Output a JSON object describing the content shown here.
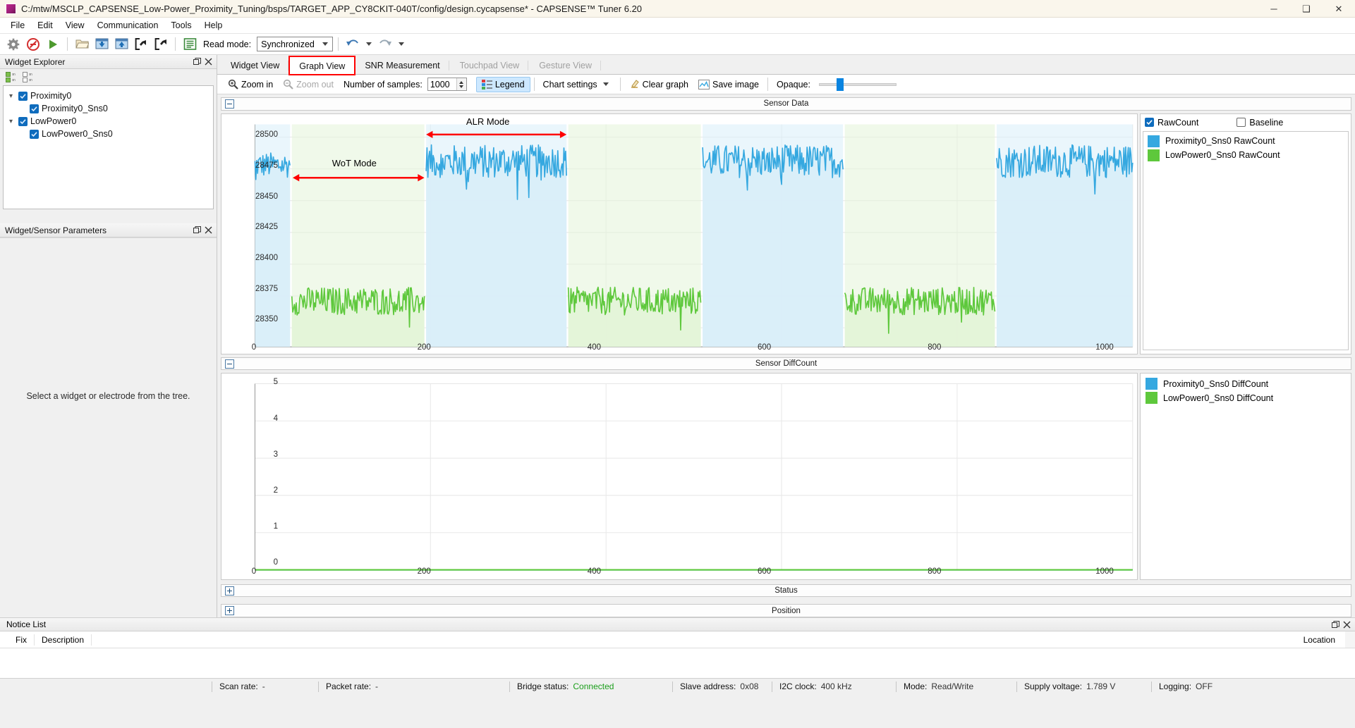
{
  "window": {
    "title": "C:/mtw/MSCLP_CAPSENSE_Low-Power_Proximity_Tuning/bsps/TARGET_APP_CY8CKIT-040T/config/design.cycapsense* - CAPSENSE™ Tuner 6.20",
    "minimize": "─",
    "maximize": "❑",
    "close": "✕"
  },
  "menu": {
    "items": [
      "File",
      "Edit",
      "View",
      "Communication",
      "Tools",
      "Help"
    ]
  },
  "toolbar": {
    "read_mode_label": "Read mode:",
    "read_mode_value": "Synchronized",
    "icons": [
      "settings-gear",
      "disconnect",
      "start",
      "open-file",
      "apply-to-device",
      "apply-to-project",
      "import",
      "export",
      "log"
    ]
  },
  "tabs": [
    {
      "label": "Widget View",
      "selected": false,
      "disabled": false,
      "highlight": false
    },
    {
      "label": "Graph View",
      "selected": true,
      "disabled": false,
      "highlight": true
    },
    {
      "label": "SNR Measurement",
      "selected": false,
      "disabled": false,
      "highlight": false
    },
    {
      "label": "Touchpad View",
      "selected": false,
      "disabled": true,
      "highlight": false
    },
    {
      "label": "Gesture View",
      "selected": false,
      "disabled": true,
      "highlight": false
    }
  ],
  "graph_toolbar": {
    "zoom_in": "Zoom in",
    "zoom_out": "Zoom out",
    "samples_label": "Number of samples:",
    "samples_value": "1000",
    "legend": "Legend",
    "chart_settings": "Chart settings",
    "clear_graph": "Clear graph",
    "save_image": "Save image",
    "opaque_label": "Opaque:"
  },
  "widget_explorer": {
    "title": "Widget Explorer",
    "tree": [
      {
        "label": "Proximity0",
        "level": 0,
        "checked": true,
        "expanded": true
      },
      {
        "label": "Proximity0_Sns0",
        "level": 1,
        "checked": true
      },
      {
        "label": "LowPower0",
        "level": 0,
        "checked": true,
        "expanded": true
      },
      {
        "label": "LowPower0_Sns0",
        "level": 1,
        "checked": true
      }
    ]
  },
  "widget_params": {
    "title": "Widget/Sensor Parameters",
    "empty_message": "Select a widget or electrode from the tree."
  },
  "sections": {
    "sensor_data": "Sensor Data",
    "sensor_diffcount": "Sensor DiffCount",
    "status": "Status",
    "position": "Position"
  },
  "raw_legend": {
    "rawcount_label": "RawCount",
    "rawcount_checked": true,
    "baseline_label": "Baseline",
    "baseline_checked": false,
    "series": [
      {
        "name": "Proximity0_Sns0 RawCount",
        "color": "#35a8e0"
      },
      {
        "name": "LowPower0_Sns0 RawCount",
        "color": "#5ec83c"
      }
    ]
  },
  "diff_legend": {
    "series": [
      {
        "name": "Proximity0_Sns0 DiffCount",
        "color": "#35a8e0"
      },
      {
        "name": "LowPower0_Sns0 DiffCount",
        "color": "#5ec83c"
      }
    ]
  },
  "annotations": {
    "wot": "WoT Mode",
    "alr": "ALR Mode"
  },
  "notice_list": {
    "title": "Notice List",
    "col_fix": "Fix",
    "col_description": "Description",
    "col_location": "Location"
  },
  "status_bar": [
    {
      "key": "Scan rate:",
      "value": "-",
      "state": ""
    },
    {
      "key": "Packet rate:",
      "value": "-",
      "state": ""
    },
    {
      "key": "Bridge status:",
      "value": "Connected",
      "state": "ok"
    },
    {
      "key": "Slave address:",
      "value": "0x08",
      "state": ""
    },
    {
      "key": "I2C clock:",
      "value": "400 kHz",
      "state": ""
    },
    {
      "key": "Mode:",
      "value": "Read/Write",
      "state": ""
    },
    {
      "key": "Supply voltage:",
      "value": "1.789 V",
      "state": ""
    },
    {
      "key": "Logging:",
      "value": "OFF",
      "state": ""
    }
  ],
  "chart_data": [
    {
      "id": "sensor-data",
      "type": "line",
      "title": "Sensor Data",
      "xlabel": "",
      "ylabel": "",
      "xlim": [
        0,
        1000
      ],
      "ylim": [
        28335,
        28510
      ],
      "xticks": [
        0,
        200,
        400,
        600,
        800,
        1000
      ],
      "yticks": [
        28350,
        28375,
        28400,
        28425,
        28450,
        28475,
        28500
      ],
      "grid": true,
      "legend_position": "right",
      "series": [
        {
          "name": "Proximity0_Sns0 RawCount",
          "color": "#35a8e0",
          "fill": "#d9eef9",
          "segments": [
            {
              "x_start": 0,
              "x_end": 40,
              "mean": 28478,
              "noise": 10
            },
            {
              "x_start": 195,
              "x_end": 355,
              "mean": 28481,
              "noise": 13
            },
            {
              "x_start": 510,
              "x_end": 670,
              "mean": 28481,
              "noise": 13
            },
            {
              "x_start": 845,
              "x_end": 1000,
              "mean": 28481,
              "noise": 13
            }
          ]
        },
        {
          "name": "LowPower0_Sns0 RawCount",
          "color": "#5ec83c",
          "fill": "#e4f4d8",
          "segments": [
            {
              "x_start": 42,
              "x_end": 193,
              "mean": 28371,
              "noise": 11
            },
            {
              "x_start": 357,
              "x_end": 508,
              "mean": 28371,
              "noise": 11
            },
            {
              "x_start": 672,
              "x_end": 843,
              "mean": 28371,
              "noise": 11
            }
          ]
        }
      ],
      "annotations": [
        {
          "text": "WoT Mode",
          "x_start": 43,
          "x_end": 193,
          "y": 28468
        },
        {
          "text": "ALR Mode",
          "x_start": 195,
          "x_end": 355,
          "y": 28502
        }
      ]
    },
    {
      "id": "sensor-diffcount",
      "type": "line",
      "title": "Sensor DiffCount",
      "xlim": [
        0,
        1000
      ],
      "ylim": [
        0,
        5
      ],
      "xticks": [
        0,
        200,
        400,
        600,
        800,
        1000
      ],
      "yticks": [
        0,
        1,
        2,
        3,
        4,
        5
      ],
      "grid": true,
      "legend_position": "right",
      "series": [
        {
          "name": "Proximity0_Sns0 DiffCount",
          "color": "#35a8e0",
          "constant": 0
        },
        {
          "name": "LowPower0_Sns0 DiffCount",
          "color": "#5ec83c",
          "constant": 0
        }
      ]
    }
  ]
}
